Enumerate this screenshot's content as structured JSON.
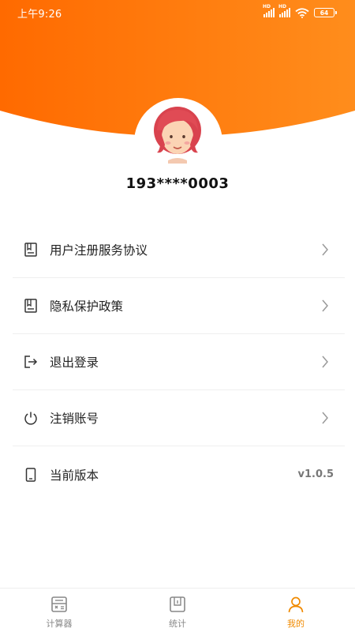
{
  "status_bar": {
    "time": "上午9:26",
    "signal1_label": "HD",
    "signal2_label": "HD",
    "battery": "64"
  },
  "colors": {
    "header_gradient_start": "#ff6b00",
    "header_gradient_end": "#ff8c1a",
    "active_tab": "#f08a00"
  },
  "profile": {
    "phone": "193****0003",
    "avatar": "avatar-girl-icon"
  },
  "menu": {
    "items": [
      {
        "label": "用户注册服务协议",
        "icon": "document-icon",
        "has_chevron": true
      },
      {
        "label": "隐私保护政策",
        "icon": "document-icon",
        "has_chevron": true
      },
      {
        "label": "退出登录",
        "icon": "logout-icon",
        "has_chevron": true
      },
      {
        "label": "注销账号",
        "icon": "power-icon",
        "has_chevron": true
      },
      {
        "label": "当前版本",
        "icon": "phone-icon",
        "value": "v1.0.5"
      }
    ]
  },
  "bottom_nav": {
    "tabs": [
      {
        "label": "计算器",
        "icon": "calculator-icon",
        "active": false
      },
      {
        "label": "统计",
        "icon": "stats-icon",
        "active": false
      },
      {
        "label": "我的",
        "icon": "person-icon",
        "active": true
      }
    ]
  }
}
